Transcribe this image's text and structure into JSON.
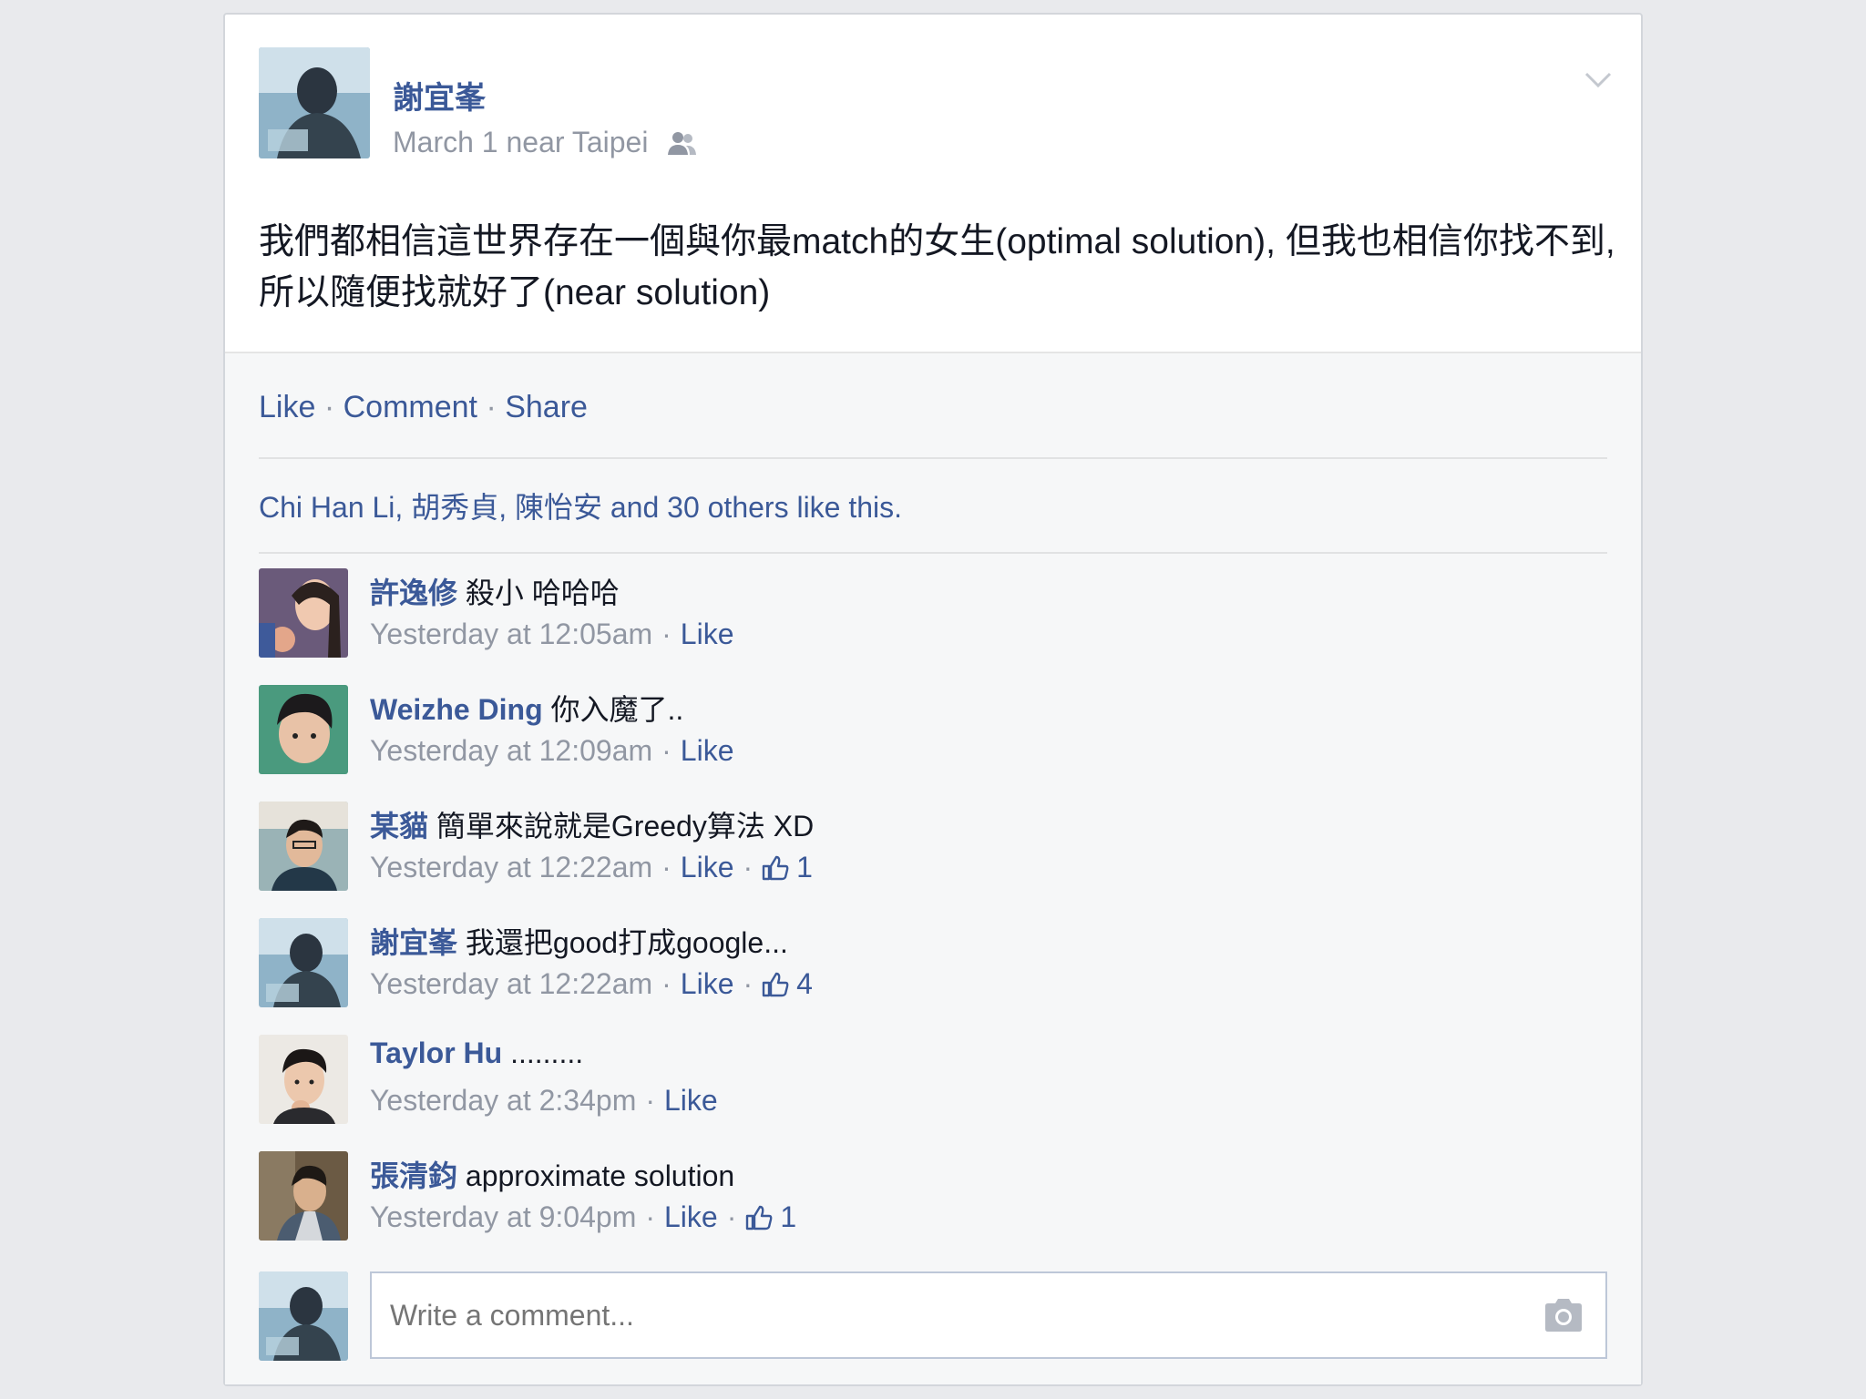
{
  "post": {
    "author": "謝宜峯",
    "meta_text": "March 1 near Taipei",
    "privacy_icon": "friends-icon",
    "text": "我們都相信這世界存在一個與你最match的女生(optimal solution), 但我也相信你找不到, 所以隨便找就好了(near solution)"
  },
  "actions": {
    "like": "Like",
    "comment": "Comment",
    "share": "Share",
    "separator": "·"
  },
  "likes_summary": "Chi Han Li, 胡秀貞, 陳怡安 and 30 others like this.",
  "comments": [
    {
      "author": "許逸修",
      "text": "殺小 哈哈哈",
      "time": "Yesterday at 12:05am",
      "like_label": "Like",
      "likes": ""
    },
    {
      "author": "Weizhe Ding",
      "text": "你入魔了..",
      "time": "Yesterday at 12:09am",
      "like_label": "Like",
      "likes": ""
    },
    {
      "author": "某貓",
      "text": "簡單來說就是Greedy算法 XD",
      "time": "Yesterday at 12:22am",
      "like_label": "Like",
      "likes": "1"
    },
    {
      "author": "謝宜峯",
      "text": "我還把good打成google...",
      "time": "Yesterday at 12:22am",
      "like_label": "Like",
      "likes": "4"
    },
    {
      "author": "Taylor Hu",
      "text": ".........",
      "time": "Yesterday at 2:34pm",
      "like_label": "Like",
      "likes": ""
    },
    {
      "author": "張清鈞",
      "text": "approximate solution",
      "time": "Yesterday at 9:04pm",
      "like_label": "Like",
      "likes": "1"
    }
  ],
  "compose": {
    "placeholder": "Write a comment..."
  },
  "colors": {
    "link": "#3b5998",
    "meta": "#9197a3",
    "text": "#141823",
    "footer_bg": "#f6f7f8"
  }
}
